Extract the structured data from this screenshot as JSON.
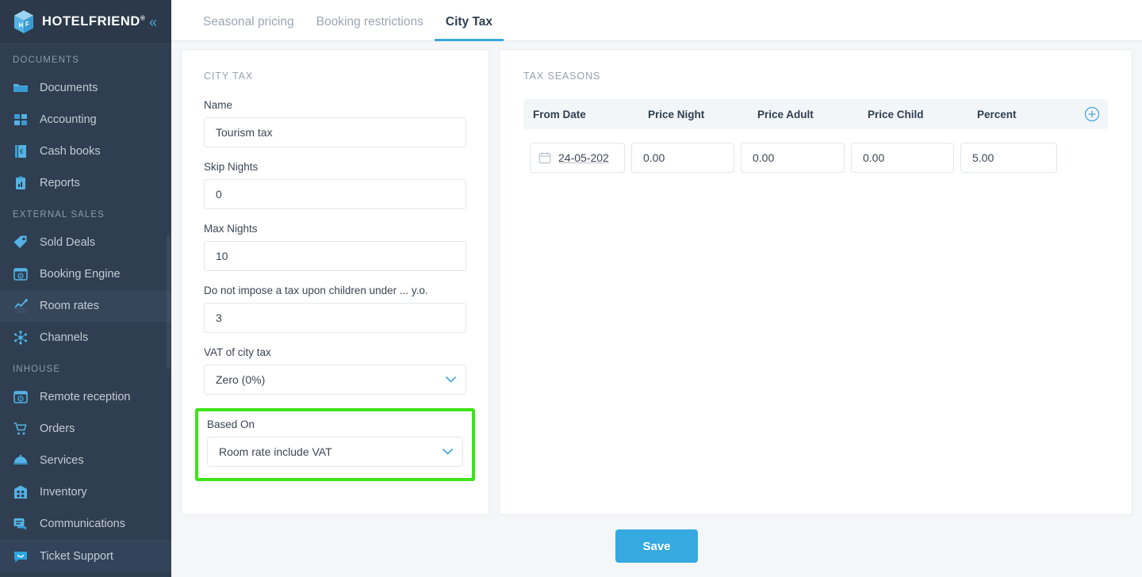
{
  "brand": {
    "name": "HOTELFRIEND",
    "registered_mark": "®",
    "logo_icon": "hotelfriend-cube-logo",
    "collapse_icon": "chevron-double-left-icon"
  },
  "sidebar": {
    "sections": [
      {
        "title": "DOCUMENTS",
        "items": [
          {
            "label": "Documents",
            "icon": "folder-icon",
            "active": false
          },
          {
            "label": "Accounting",
            "icon": "calculator-icon",
            "active": false
          },
          {
            "label": "Cash books",
            "icon": "cash-book-icon",
            "active": false
          },
          {
            "label": "Reports",
            "icon": "clipboard-report-icon",
            "active": false
          }
        ]
      },
      {
        "title": "EXTERNAL SALES",
        "items": [
          {
            "label": "Sold Deals",
            "icon": "tag-icon",
            "active": false
          },
          {
            "label": "Booking Engine",
            "icon": "browser-gear-icon",
            "active": false
          },
          {
            "label": "Room rates",
            "icon": "chart-growth-icon",
            "active": true
          },
          {
            "label": "Channels",
            "icon": "network-nodes-icon",
            "active": false
          }
        ]
      },
      {
        "title": "INHOUSE",
        "items": [
          {
            "label": "Remote reception",
            "icon": "browser-gear-icon",
            "active": false
          },
          {
            "label": "Orders",
            "icon": "shopping-cart-icon",
            "active": false
          },
          {
            "label": "Services",
            "icon": "room-service-dome-icon",
            "active": false
          },
          {
            "label": "Inventory",
            "icon": "building-grid-icon",
            "active": false
          },
          {
            "label": "Communications",
            "icon": "chat-bubble-icon",
            "active": false
          },
          {
            "label": "Ticket Support",
            "icon": "smiley-chat-icon",
            "active": false
          }
        ]
      }
    ]
  },
  "tabs": [
    {
      "label": "Seasonal pricing",
      "active": false
    },
    {
      "label": "Booking restrictions",
      "active": false
    },
    {
      "label": "City Tax",
      "active": true
    }
  ],
  "city_tax_panel": {
    "caption": "CITY TAX",
    "fields": {
      "name": {
        "label": "Name",
        "value": "Tourism tax"
      },
      "skip_nights": {
        "label": "Skip Nights",
        "value": "0"
      },
      "max_nights": {
        "label": "Max Nights",
        "value": "10"
      },
      "children_under": {
        "label": "Do not impose a tax upon children under ... y.o.",
        "value": "3"
      },
      "vat_of_city_tax": {
        "label": "VAT of city tax",
        "value": "Zero (0%)"
      },
      "based_on": {
        "label": "Based On",
        "value": "Room rate include VAT"
      }
    },
    "dropdown_icon": "chevron-down-icon",
    "highlight_color": "#3ee318"
  },
  "tax_seasons_panel": {
    "caption": "TAX SEASONS",
    "add_icon": "plus-circle-icon",
    "columns": [
      "From Date",
      "Price Night",
      "Price Adult",
      "Price Child",
      "Percent"
    ],
    "rows": [
      {
        "from_date": "24-05-202",
        "date_icon": "calendar-icon",
        "price_night": "0.00",
        "price_adult": "0.00",
        "price_child": "0.00",
        "percent": "5.00"
      }
    ]
  },
  "footer": {
    "save_label": "Save",
    "accent_color": "#36a9e1"
  }
}
